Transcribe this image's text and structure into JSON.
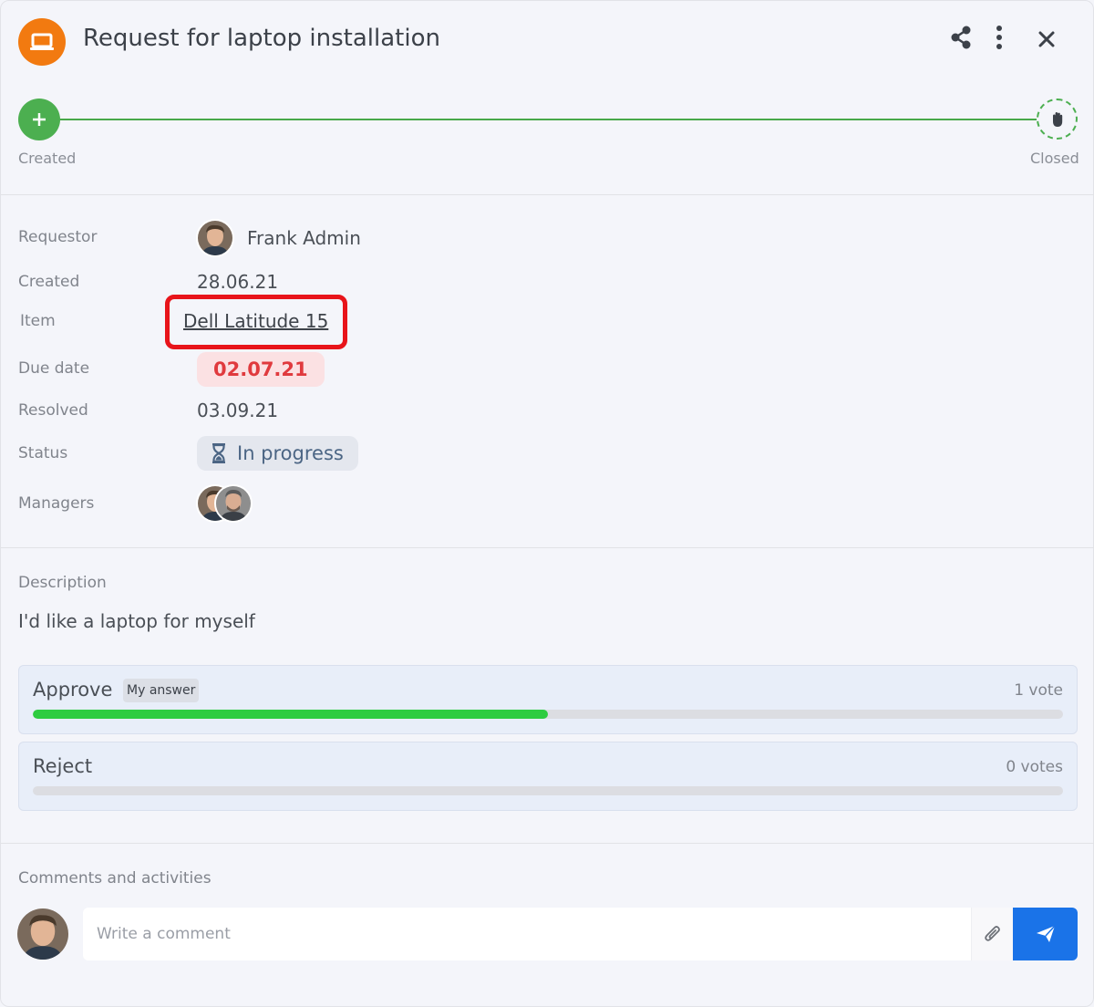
{
  "header": {
    "title": "Request for laptop installation",
    "icon": "laptop-icon",
    "accent_color": "#f27a10"
  },
  "timeline": {
    "start_label": "Created",
    "end_label": "Closed",
    "color": "#4caf50"
  },
  "details": {
    "requestor_label": "Requestor",
    "requestor_name": "Frank Admin",
    "created_label": "Created",
    "created_value": "28.06.21",
    "item_label": "Item",
    "item_value": "Dell Latitude 15",
    "due_label": "Due date",
    "due_value": "02.07.21",
    "resolved_label": "Resolved",
    "resolved_value": "03.09.21",
    "status_label": "Status",
    "status_value": "In progress",
    "status_icon": "hourglass-icon",
    "managers_label": "Managers"
  },
  "description": {
    "label": "Description",
    "text": "I'd like a laptop for myself"
  },
  "votes": [
    {
      "label": "Approve",
      "badge": "My answer",
      "count": "1 vote",
      "fraction": 0.5
    },
    {
      "label": "Reject",
      "badge": "",
      "count": "0 votes",
      "fraction": 0
    }
  ],
  "comments": {
    "label": "Comments and activities",
    "placeholder": "Write a comment"
  },
  "colors": {
    "highlight": "#e8141a",
    "due_text": "#e03a3e",
    "send_button": "#1a73e8",
    "vote_fill": "#2ecc40"
  }
}
